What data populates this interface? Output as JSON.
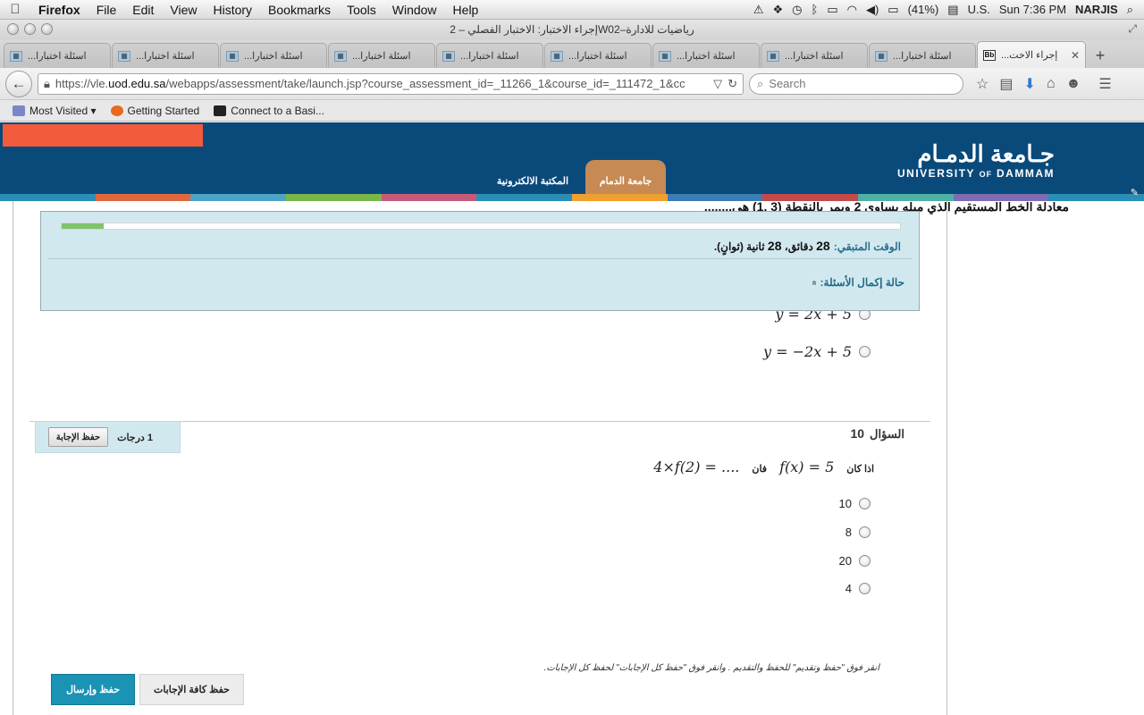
{
  "menubar": {
    "apple": "",
    "items": [
      "Firefox",
      "File",
      "Edit",
      "View",
      "History",
      "Bookmarks",
      "Tools",
      "Window",
      "Help"
    ],
    "battery": "(41%)",
    "input_source": "U.S.",
    "clock": "Sun 7:36 PM",
    "user": "NARJIS"
  },
  "window": {
    "title": "إجراء الاختبار: الاختبار الفصلي – 2W02–رياضيات للادارة"
  },
  "tabs": {
    "items": [
      {
        "label": "...اسئلة اختبارا"
      },
      {
        "label": "...اسئلة اختبارا"
      },
      {
        "label": "...اسئلة اختبارا"
      },
      {
        "label": "...اسئلة اختبارا"
      },
      {
        "label": "...اسئلة اختبارا"
      },
      {
        "label": "...اسئلة اختبارا"
      },
      {
        "label": "...اسئلة اختبارا"
      },
      {
        "label": "...اسئلة اختبارا"
      },
      {
        "label": "...اسئلة اختبارا"
      }
    ],
    "active": {
      "favicon": "Bb",
      "label": "...إجراء الاخت",
      "close": "✕"
    },
    "new_tab": "+"
  },
  "navbar": {
    "url_prefix": "https://vle.",
    "url_domain": "uod.edu.sa",
    "url_rest": "/webapps/assessment/take/launch.jsp?course_assessment_id=_11266_1&course_id=_111472_1&cc",
    "search_placeholder": "Search"
  },
  "bookmarks": {
    "items": [
      {
        "label": "Most Visited ▾",
        "color": "#7c86c6"
      },
      {
        "label": "Getting Started",
        "color": "#e66a1f"
      },
      {
        "label": "Connect to a Basi...",
        "color": "#222222"
      }
    ]
  },
  "site": {
    "logo_ar": "جـامعة الدمـام",
    "logo_en_1": "UNIVERSITY",
    "logo_en_of": "OF",
    "logo_en_2": "DAMMAM",
    "nav_home": "جامعة الدمام",
    "nav_library": "المكتبة الالكترونية",
    "stripe_colors": [
      "#2b8fb5",
      "#e0673c",
      "#4fa3c6",
      "#7ab648",
      "#c75a7a",
      "#2b8fb5",
      "#f0a030",
      "#3d7db5",
      "#c44a4a",
      "#4fb0a3",
      "#7d6cb3",
      "#2b8fb5"
    ]
  },
  "timer": {
    "progress": 0.05,
    "label": "الوقت المتبقي:",
    "minutes": "28",
    "minutes_unit": "دقائق،",
    "seconds": "28",
    "seconds_unit": "ثانية (ثوانٍ).",
    "status_label": "حالة إكمال الأسئلة:",
    "status_icon": "»"
  },
  "question9": {
    "overflow_text": "معادلة الخط المستقيم الذي ميله يساوي 2 ويمر بالنقطة (3 ,1) هي........",
    "options": [
      "y = 2x + 5",
      "y = −2x + 5"
    ]
  },
  "question10": {
    "label": "السؤال",
    "number": "10",
    "points": "1 درجات",
    "save_button": "حفظ الإجابة",
    "if_word": "اذا كان",
    "given": "f(x) = 5",
    "then_word": "فان",
    "expression": "4×f(2) = ....",
    "options": [
      "10",
      "8",
      "20",
      "4"
    ]
  },
  "footer": {
    "instructions": "انقر فوق \"حفظ وتقديم\" للحفظ والتقديم . وانقر فوق \"حفظ كل الإجابات\" لحفظ كل الإجابات.",
    "submit_button": "حفظ وإرسال",
    "save_all_button": "حفظ كافة الإجابات"
  }
}
